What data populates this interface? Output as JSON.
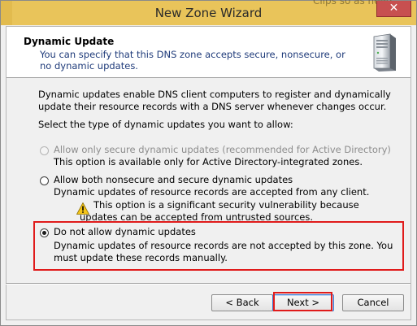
{
  "window": {
    "title": "New Zone Wizard",
    "close_glyph": "✕",
    "background_fragment_text": "Clips so as need"
  },
  "header": {
    "title": "Dynamic Update",
    "subtitle": "You can specify that this DNS zone accepts secure, nonsecure, or no dynamic updates.",
    "icon": "server-icon"
  },
  "intro": "Dynamic updates enable DNS client computers to register and dynamically update their resource records with a DNS server whenever changes occur.",
  "prompt": "Select the type of dynamic updates you want to allow:",
  "options": [
    {
      "label": "Allow only secure dynamic updates (recommended for Active Directory)",
      "description": "This option is available only for Active Directory-integrated zones.",
      "enabled": false,
      "selected": false
    },
    {
      "label": "Allow both nonsecure and secure dynamic updates",
      "description": "Dynamic updates of resource records are accepted from any client.",
      "warning": "This option is a significant security vulnerability because updates can be accepted from untrusted sources.",
      "enabled": true,
      "selected": false
    },
    {
      "label": "Do not allow dynamic updates",
      "description": "Dynamic updates of resource records are not accepted by this zone. You must update these records manually.",
      "enabled": true,
      "selected": true
    }
  ],
  "buttons": {
    "back": "< Back",
    "next": "Next >",
    "cancel": "Cancel"
  },
  "colors": {
    "title_bar": "#e9c45a",
    "highlight": "#e01b1b",
    "subtitle_text": "#1f3b7a"
  }
}
